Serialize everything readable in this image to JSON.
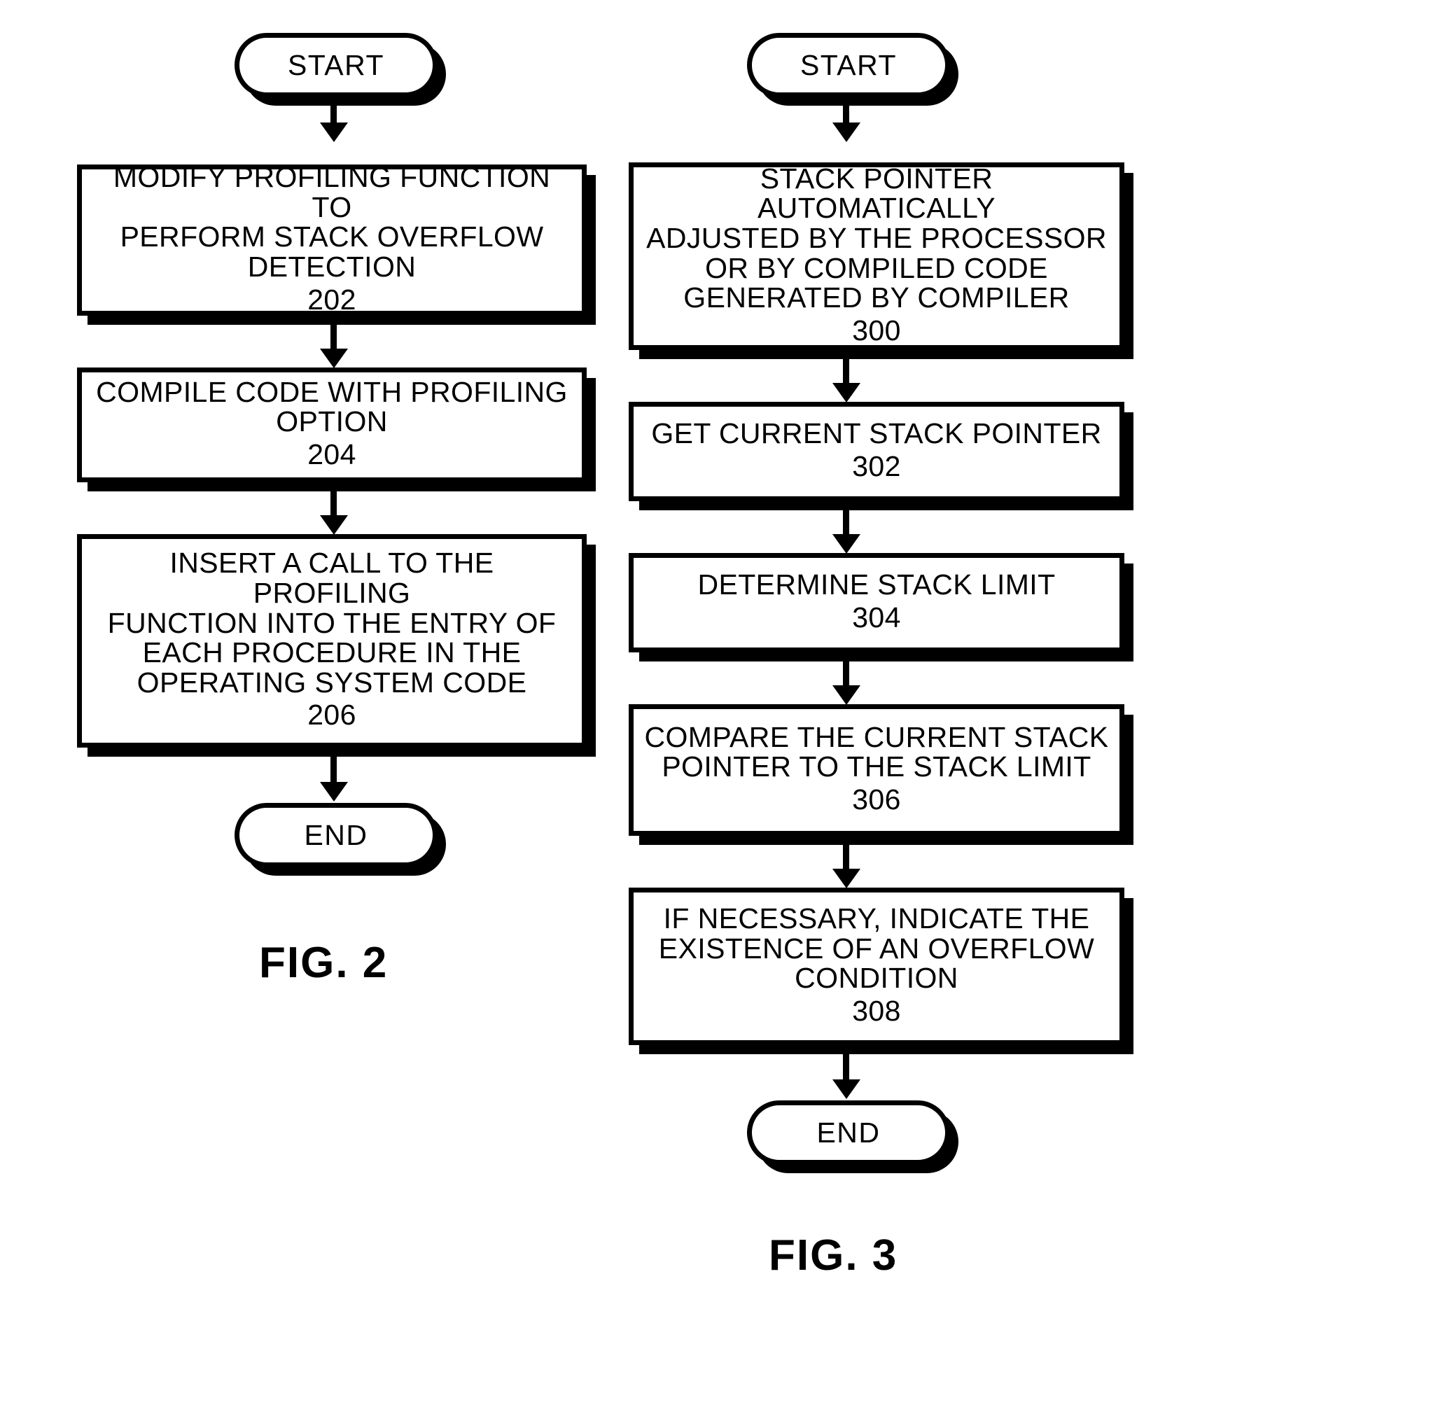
{
  "figure2": {
    "caption": "FIG. 2",
    "start_label": "START",
    "end_label": "END",
    "steps": [
      {
        "text": "MODIFY PROFILING FUNCTION TO\nPERFORM STACK OVERFLOW\nDETECTION",
        "number": "202"
      },
      {
        "text": "COMPILE CODE WITH PROFILING\nOPTION",
        "number": "204"
      },
      {
        "text": "INSERT A CALL TO THE PROFILING\nFUNCTION INTO THE ENTRY OF\nEACH PROCEDURE IN THE\nOPERATING SYSTEM CODE",
        "number": "206"
      }
    ]
  },
  "figure3": {
    "caption": "FIG. 3",
    "start_label": "START",
    "end_label": "END",
    "steps": [
      {
        "text": "STACK POINTER AUTOMATICALLY\nADJUSTED BY THE PROCESSOR\nOR BY COMPILED CODE\nGENERATED BY COMPILER",
        "number": "300"
      },
      {
        "text": "GET CURRENT STACK POINTER",
        "number": "302"
      },
      {
        "text": "DETERMINE STACK LIMIT",
        "number": "304"
      },
      {
        "text": "COMPARE THE CURRENT STACK\nPOINTER TO THE STACK LIMIT",
        "number": "306"
      },
      {
        "text": "IF NECESSARY, INDICATE THE\nEXISTENCE OF AN OVERFLOW\nCONDITION",
        "number": "308"
      }
    ]
  }
}
